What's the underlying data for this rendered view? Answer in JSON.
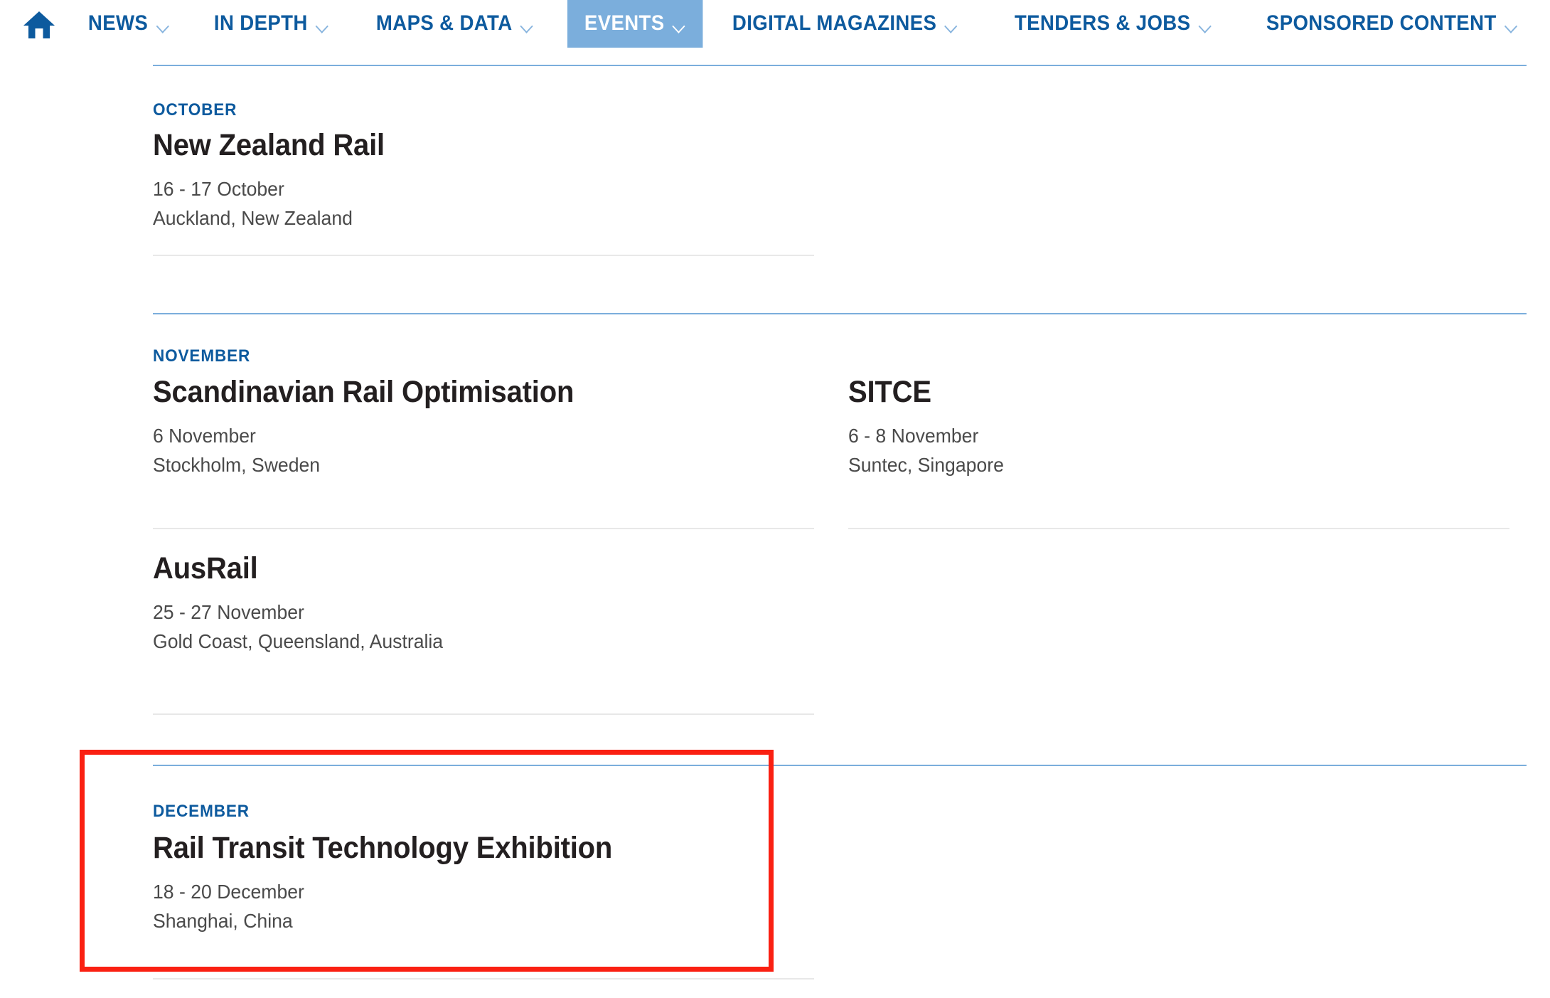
{
  "nav": {
    "home_icon": "home-icon",
    "items": [
      {
        "label": "NEWS",
        "has_dropdown": true,
        "active": false
      },
      {
        "label": "IN DEPTH",
        "has_dropdown": true,
        "active": false
      },
      {
        "label": "MAPS & DATA",
        "has_dropdown": true,
        "active": false
      },
      {
        "label": "EVENTS",
        "has_dropdown": true,
        "active": true
      },
      {
        "label": "DIGITAL MAGAZINES",
        "has_dropdown": true,
        "active": false
      },
      {
        "label": "TENDERS & JOBS",
        "has_dropdown": true,
        "active": false
      },
      {
        "label": "SPONSORED CONTENT",
        "has_dropdown": true,
        "active": false
      }
    ],
    "active_label": "EVENTS"
  },
  "colors": {
    "nav_text": "#0D5A9E",
    "nav_active_bg": "#7BAEDC",
    "nav_active_text": "#FFFFFF",
    "month_label": "#0D5A9E",
    "event_title": "#231F20",
    "event_meta": "#4A4A4A",
    "rule_blue": "#7BAEDC",
    "rule_gray": "#E8E8E8",
    "highlight_border": "#FA2012"
  },
  "months": [
    {
      "label": "OCTOBER",
      "events": [
        {
          "title": "New Zealand Rail",
          "date": "16 - 17 October",
          "location": "Auckland, New Zealand",
          "column": "left"
        }
      ]
    },
    {
      "label": "NOVEMBER",
      "events": [
        {
          "title": "Scandinavian Rail Optimisation",
          "date": "6 November",
          "location": "Stockholm, Sweden",
          "column": "left"
        },
        {
          "title": "SITCE",
          "date": "6 - 8 November",
          "location": "Suntec, Singapore",
          "column": "right"
        },
        {
          "title": "AusRail",
          "date": "25 - 27 November",
          "location": "Gold Coast, Queensland, Australia",
          "column": "left"
        }
      ]
    },
    {
      "label": "DECEMBER",
      "highlighted": true,
      "events": [
        {
          "title": "Rail Transit Technology Exhibition",
          "date": "18 - 20 December",
          "location": "Shanghai, China",
          "column": "left"
        }
      ]
    }
  ]
}
